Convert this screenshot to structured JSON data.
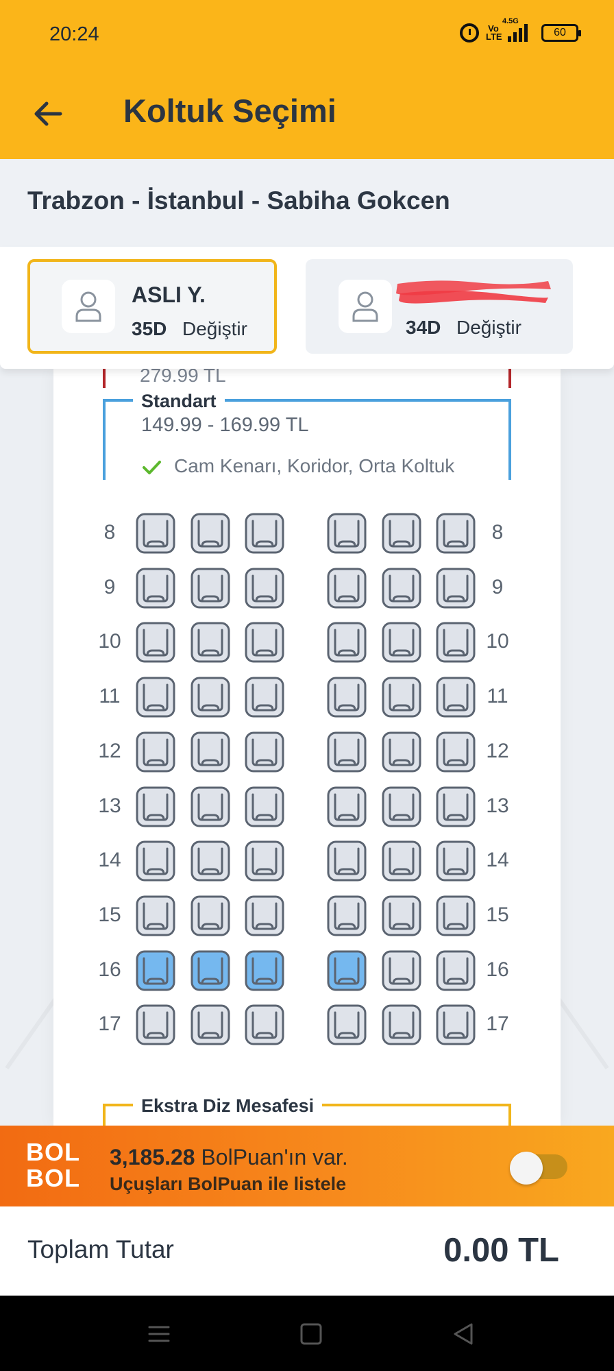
{
  "status_bar": {
    "time": "20:24",
    "volte": "Vo LTE",
    "network": "4.5G",
    "battery": "60"
  },
  "header": {
    "title": "Koltuk Seçimi"
  },
  "route": {
    "text": "Trabzon - İstanbul - Sabiha Gokcen"
  },
  "passengers": [
    {
      "name": "ASLI Y.",
      "seat": "35D",
      "change_label": "Değiştir",
      "active": true
    },
    {
      "name": "",
      "seat": "34D",
      "change_label": "Değiştir",
      "active": false
    }
  ],
  "previous_zone": {
    "price": "279.99 TL"
  },
  "standard_zone": {
    "label": "Standart",
    "price_range": "149.99 - 169.99 TL",
    "feature": "Cam Kenarı, Koridor, Orta Koltuk"
  },
  "extra_zone": {
    "label": "Ekstra Diz Mesafesi"
  },
  "seat_rows": [
    {
      "row": "8",
      "seats": [
        "available",
        "available",
        "available",
        "available",
        "available",
        "available"
      ]
    },
    {
      "row": "9",
      "seats": [
        "available",
        "available",
        "available",
        "available",
        "available",
        "available"
      ]
    },
    {
      "row": "10",
      "seats": [
        "available",
        "available",
        "available",
        "available",
        "available",
        "available"
      ]
    },
    {
      "row": "11",
      "seats": [
        "available",
        "available",
        "available",
        "available",
        "available",
        "available"
      ]
    },
    {
      "row": "12",
      "seats": [
        "available",
        "available",
        "available",
        "available",
        "available",
        "available"
      ]
    },
    {
      "row": "13",
      "seats": [
        "available",
        "available",
        "available",
        "available",
        "available",
        "available"
      ]
    },
    {
      "row": "14",
      "seats": [
        "available",
        "available",
        "available",
        "available",
        "available",
        "available"
      ]
    },
    {
      "row": "15",
      "seats": [
        "available",
        "available",
        "available",
        "available",
        "available",
        "available"
      ]
    },
    {
      "row": "16",
      "seats": [
        "selected",
        "selected",
        "selected",
        "selected",
        "available",
        "available"
      ]
    },
    {
      "row": "17",
      "seats": [
        "available",
        "available",
        "available",
        "available",
        "available",
        "available"
      ]
    }
  ],
  "colors": {
    "brand_yellow": "#fbb519",
    "seat_available": "#dfe3ea",
    "seat_selected": "#75b8ef",
    "seat_outline": "#5b6471",
    "standard_zone": "#4aa0dd",
    "check_green": "#5cb82d"
  },
  "bolbol": {
    "logo_line1": "BOL",
    "logo_line2": "BOL",
    "points": "3,185.28",
    "points_suffix": "BolPuan'ın var.",
    "subtitle": "Uçuşları BolPuan ile listele",
    "toggle_on": false
  },
  "total": {
    "label": "Toplam Tutar",
    "value": "0.00 TL"
  },
  "icons": [
    "back-arrow-icon",
    "user-icon",
    "check-icon",
    "seat-icon",
    "menu-icon",
    "home-icon",
    "back-icon",
    "alarm-icon",
    "signal-icon",
    "battery-icon"
  ]
}
